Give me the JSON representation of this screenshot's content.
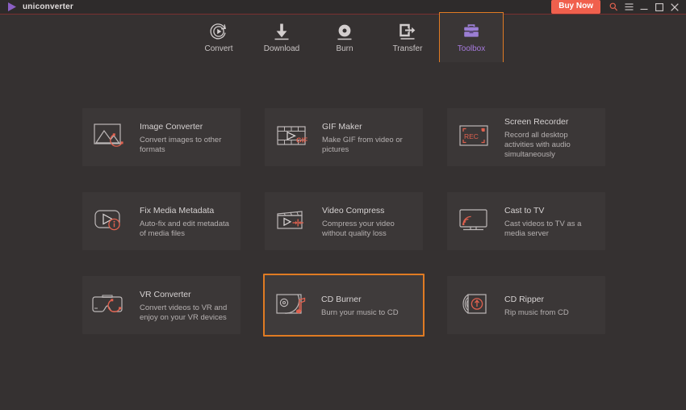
{
  "titlebar": {
    "brand": "uniconverter",
    "logo_icon": "play-triangle-logo",
    "buy_now": "Buy Now",
    "controls": [
      {
        "name": "search-icon",
        "glyph": "⌕"
      },
      {
        "name": "menu-icon",
        "glyph": "☰"
      },
      {
        "name": "minimize-icon",
        "glyph": "–"
      },
      {
        "name": "maximize-icon",
        "glyph": "☐"
      },
      {
        "name": "close-icon",
        "glyph": "✕"
      }
    ]
  },
  "nav": {
    "items": [
      {
        "label": "Convert",
        "icon": "convert-icon",
        "active": false
      },
      {
        "label": "Download",
        "icon": "download-icon",
        "active": false
      },
      {
        "label": "Burn",
        "icon": "burn-icon",
        "active": false
      },
      {
        "label": "Transfer",
        "icon": "transfer-icon",
        "active": false
      },
      {
        "label": "Toolbox",
        "icon": "toolbox-icon",
        "active": true
      }
    ]
  },
  "toolbox": {
    "cards": [
      {
        "title": "Image Converter",
        "desc": "Convert images to other formats",
        "icon": "image-converter-icon",
        "selected": false
      },
      {
        "title": "GIF Maker",
        "desc": "Make GIF from video or pictures",
        "icon": "gif-maker-icon",
        "selected": false
      },
      {
        "title": "Screen Recorder",
        "desc": "Record all desktop activities with audio simultaneously",
        "icon": "screen-recorder-icon",
        "selected": false
      },
      {
        "title": "Fix Media Metadata",
        "desc": "Auto-fix and edit metadata of media files",
        "icon": "fix-metadata-icon",
        "selected": false
      },
      {
        "title": "Video Compress",
        "desc": "Compress your video without quality loss",
        "icon": "video-compress-icon",
        "selected": false
      },
      {
        "title": "Cast to TV",
        "desc": "Cast videos to TV as a media server",
        "icon": "cast-to-tv-icon",
        "selected": false
      },
      {
        "title": "VR Converter",
        "desc": "Convert videos to VR and enjoy on your VR devices",
        "icon": "vr-converter-icon",
        "selected": false
      },
      {
        "title": "CD Burner",
        "desc": "Burn your music to CD",
        "icon": "cd-burner-icon",
        "selected": true
      },
      {
        "title": "CD Ripper",
        "desc": "Rip music from CD",
        "icon": "cd-ripper-icon",
        "selected": false
      }
    ]
  },
  "labels": {
    "rec_text": "REC",
    "gif_text": "GIF"
  },
  "colors": {
    "accent_purple": "#a77bde",
    "highlight_orange": "#e07b23",
    "buy_red": "#f0604d",
    "icon_red": "#e0614f",
    "window_bg": "#353131",
    "card_bg": "#3b3737",
    "titlebar_bg": "#2e2b2b"
  }
}
